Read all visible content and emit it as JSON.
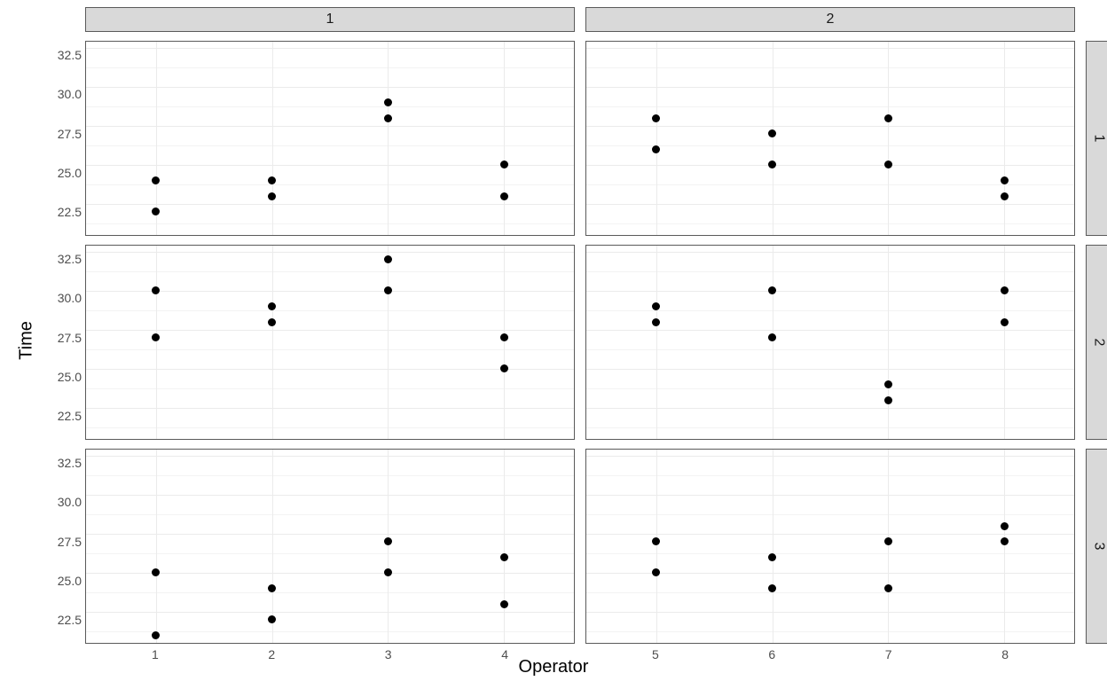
{
  "axis": {
    "xlabel": "Operator",
    "ylabel": "Time"
  },
  "y_ticks": [
    "22.5",
    "25.0",
    "27.5",
    "30.0",
    "32.5"
  ],
  "col_strips": [
    "1",
    "2"
  ],
  "row_strips": [
    "1",
    "2",
    "3"
  ],
  "x_ticks_left": [
    "1",
    "2",
    "3",
    "4"
  ],
  "x_ticks_right": [
    "5",
    "6",
    "7",
    "8"
  ],
  "chart_data": {
    "type": "scatter",
    "facets": {
      "columns": [
        "1",
        "2"
      ],
      "rows": [
        "1",
        "2",
        "3"
      ]
    },
    "xlabel": "Operator",
    "ylabel": "Time",
    "ylim": [
      20.5,
      32.9
    ],
    "y_breaks": [
      22.5,
      25.0,
      27.5,
      30.0,
      32.5
    ],
    "x_operators": {
      "col1": [
        1,
        2,
        3,
        4
      ],
      "col2": [
        5,
        6,
        7,
        8
      ]
    },
    "panels": [
      {
        "row": "1",
        "col": "1",
        "points": [
          {
            "x": 1,
            "y": 22
          },
          {
            "x": 1,
            "y": 24
          },
          {
            "x": 2,
            "y": 23
          },
          {
            "x": 2,
            "y": 24
          },
          {
            "x": 3,
            "y": 28
          },
          {
            "x": 3,
            "y": 29
          },
          {
            "x": 4,
            "y": 23
          },
          {
            "x": 4,
            "y": 25
          }
        ]
      },
      {
        "row": "1",
        "col": "2",
        "points": [
          {
            "x": 5,
            "y": 26
          },
          {
            "x": 5,
            "y": 28
          },
          {
            "x": 6,
            "y": 25
          },
          {
            "x": 6,
            "y": 27
          },
          {
            "x": 7,
            "y": 25
          },
          {
            "x": 7,
            "y": 28
          },
          {
            "x": 8,
            "y": 23
          },
          {
            "x": 8,
            "y": 24
          }
        ]
      },
      {
        "row": "2",
        "col": "1",
        "points": [
          {
            "x": 1,
            "y": 27
          },
          {
            "x": 1,
            "y": 30
          },
          {
            "x": 2,
            "y": 28
          },
          {
            "x": 2,
            "y": 29
          },
          {
            "x": 3,
            "y": 30
          },
          {
            "x": 3,
            "y": 32
          },
          {
            "x": 4,
            "y": 25
          },
          {
            "x": 4,
            "y": 27
          }
        ]
      },
      {
        "row": "2",
        "col": "2",
        "points": [
          {
            "x": 5,
            "y": 28
          },
          {
            "x": 5,
            "y": 29
          },
          {
            "x": 6,
            "y": 27
          },
          {
            "x": 6,
            "y": 30
          },
          {
            "x": 7,
            "y": 23
          },
          {
            "x": 7,
            "y": 24
          },
          {
            "x": 8,
            "y": 28
          },
          {
            "x": 8,
            "y": 30
          }
        ]
      },
      {
        "row": "3",
        "col": "1",
        "points": [
          {
            "x": 1,
            "y": 21
          },
          {
            "x": 1,
            "y": 25
          },
          {
            "x": 2,
            "y": 22
          },
          {
            "x": 2,
            "y": 24
          },
          {
            "x": 3,
            "y": 25
          },
          {
            "x": 3,
            "y": 27
          },
          {
            "x": 4,
            "y": 23
          },
          {
            "x": 4,
            "y": 26
          }
        ]
      },
      {
        "row": "3",
        "col": "2",
        "points": [
          {
            "x": 5,
            "y": 25
          },
          {
            "x": 5,
            "y": 27
          },
          {
            "x": 6,
            "y": 24
          },
          {
            "x": 6,
            "y": 26
          },
          {
            "x": 7,
            "y": 24
          },
          {
            "x": 7,
            "y": 27
          },
          {
            "x": 8,
            "y": 27
          },
          {
            "x": 8,
            "y": 28
          }
        ]
      }
    ]
  }
}
